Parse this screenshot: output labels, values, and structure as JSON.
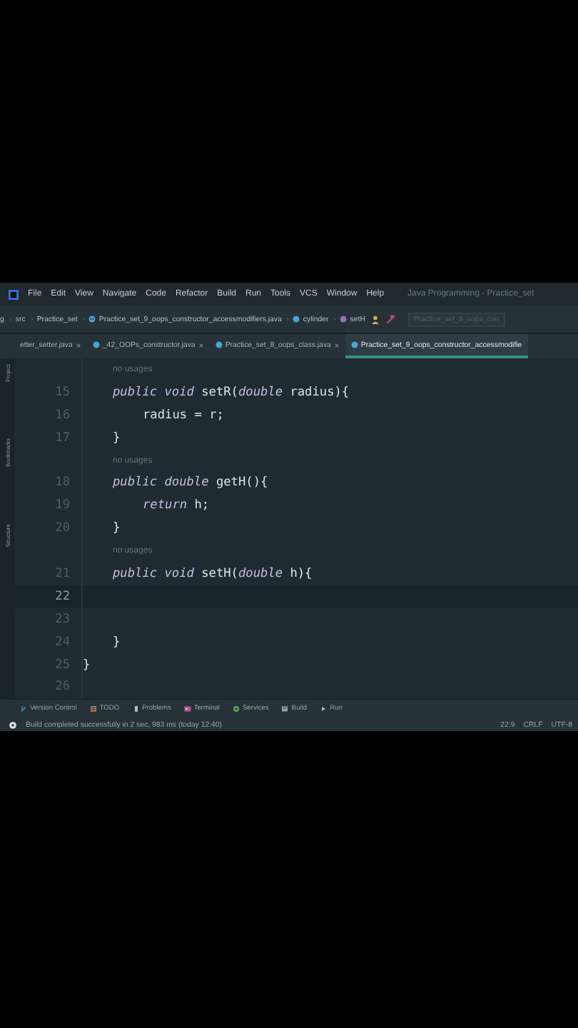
{
  "menu": {
    "items": [
      "File",
      "Edit",
      "View",
      "Navigate",
      "Code",
      "Refactor",
      "Build",
      "Run",
      "Tools",
      "VCS",
      "Window",
      "Help"
    ],
    "title": "Java Programming - Practice_set"
  },
  "breadcrumbs": [
    {
      "label": "g",
      "kind": "text"
    },
    {
      "label": "src",
      "kind": "text"
    },
    {
      "label": "Practice_set",
      "kind": "text"
    },
    {
      "label": "Practice_set_9_oops_constructor_accessmodifiers.java",
      "kind": "file"
    },
    {
      "label": "cylinder",
      "kind": "class"
    },
    {
      "label": "setH",
      "kind": "method"
    }
  ],
  "run_config": {
    "value": "Practice_set_9_oops_con"
  },
  "tabs": [
    {
      "label": "etter_setter.java",
      "selected": false
    },
    {
      "label": "_42_OOPs_constructor.java",
      "selected": false
    },
    {
      "label": "Practice_set_8_oops_class.java",
      "selected": false
    },
    {
      "label": "Practice_set_9_oops_constructor_accessmodifie",
      "selected": true
    }
  ],
  "side_tools": [
    "Project",
    "Bookmarks",
    "Structure"
  ],
  "editor": {
    "lines": [
      {
        "kind": "hint",
        "text": "no usages"
      },
      {
        "kind": "member",
        "number": "15",
        "current": false,
        "text": "*public* *void* setR(*double* radius){"
      },
      {
        "kind": "statement",
        "number": "16",
        "current": false,
        "text": "radius = r;"
      },
      {
        "kind": "member",
        "number": "17",
        "current": false,
        "text": "}"
      },
      {
        "kind": "hint",
        "text": "no usages"
      },
      {
        "kind": "member",
        "number": "18",
        "current": false,
        "text": "*public* *double* getH(){"
      },
      {
        "kind": "statement",
        "number": "19",
        "current": false,
        "text": "*return* h;"
      },
      {
        "kind": "member",
        "number": "20",
        "current": false,
        "text": "}"
      },
      {
        "kind": "hint",
        "text": "no usages"
      },
      {
        "kind": "member",
        "number": "21",
        "current": false,
        "text": "*public* *void* setH(*double* h){"
      },
      {
        "kind": "blank",
        "number": "22",
        "current": true
      },
      {
        "kind": "blank",
        "number": "23",
        "current": false
      },
      {
        "kind": "member",
        "number": "24",
        "current": false,
        "text": "}"
      },
      {
        "kind": "class_end",
        "number": "25",
        "current": false,
        "text": "}"
      },
      {
        "kind": "blank",
        "number": "26",
        "current": false
      }
    ]
  },
  "tool_buttons": [
    {
      "label": "Version Control",
      "kind": "vcs"
    },
    {
      "label": "TODO",
      "kind": "todo"
    },
    {
      "label": "Problems",
      "kind": "problems"
    },
    {
      "label": "Terminal",
      "kind": "terminal"
    },
    {
      "label": "Services",
      "kind": "services"
    },
    {
      "label": "Build",
      "kind": "build"
    },
    {
      "label": "Run",
      "kind": "run"
    }
  ],
  "status_bar": {
    "message": "Build completed successfully in 2 sec, 983 ms (today 12:40)",
    "position": "22:9",
    "line_separator": "CRLF",
    "encoding": "UTF-8"
  }
}
